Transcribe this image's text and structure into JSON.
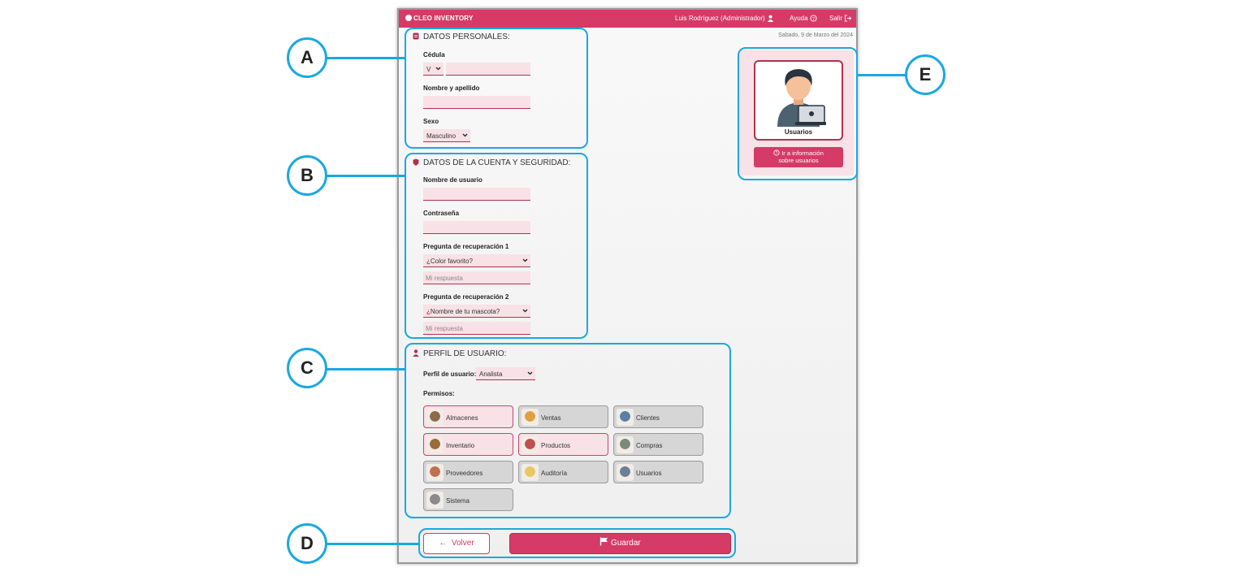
{
  "app": {
    "brand": "CLEO INVENTORY",
    "user": "Luis Rodríguez (Administrador)",
    "help": "Ayuda",
    "exit": "Salir",
    "date": "Sabado, 9 de Marzo del 2024"
  },
  "personal": {
    "title": "DATOS PERSONALES:",
    "cedula_label": "Cédula",
    "cedula_prefix": "V",
    "cedula_value": "",
    "name_label": "Nombre y apellido",
    "name_value": "",
    "sex_label": "Sexo",
    "sex_value": "Masculino"
  },
  "account": {
    "title": "DATOS DE LA CUENTA Y SEGURIDAD:",
    "username_label": "Nombre de usuario",
    "username_value": "",
    "password_label": "Contraseña",
    "password_value": "",
    "q1_label": "Pregunta de recuperación 1",
    "q1_value": "¿Color favorito?",
    "a1_placeholder": "Mi respuesta",
    "q2_label": "Pregunta de recuperación 2",
    "q2_value": "¿Nombre de tu mascota?",
    "a2_placeholder": "Mi respuesta"
  },
  "profile": {
    "title": "PERFIL DE USUARIO:",
    "profile_label": "Perfil de usuario:",
    "profile_value": "Analista",
    "permissions_label": "Permisos:",
    "permissions": [
      {
        "label": "Almacenes",
        "active": true,
        "icon": "warehouse-icon"
      },
      {
        "label": "Ventas",
        "active": false,
        "icon": "sales-icon"
      },
      {
        "label": "Clientes",
        "active": false,
        "icon": "clients-icon"
      },
      {
        "label": "Inventario",
        "active": true,
        "icon": "inventory-icon"
      },
      {
        "label": "Productos",
        "active": true,
        "icon": "products-icon"
      },
      {
        "label": "Compras",
        "active": false,
        "icon": "purchases-icon"
      },
      {
        "label": "Proveedores",
        "active": false,
        "icon": "suppliers-icon"
      },
      {
        "label": "Auditoría",
        "active": false,
        "icon": "audit-icon"
      },
      {
        "label": "Usuarios",
        "active": false,
        "icon": "users-icon"
      },
      {
        "label": "Sistema",
        "active": false,
        "icon": "system-icon"
      }
    ]
  },
  "actions": {
    "back": "Volver",
    "save": "Guardar"
  },
  "side": {
    "card_title": "Usuarios",
    "info_line1": "Ir a información",
    "info_line2": "sobre usuarios"
  },
  "callouts": [
    "A",
    "B",
    "C",
    "D",
    "E"
  ],
  "colors": {
    "primary": "#d63a67",
    "field_bg": "#f8e1e7",
    "highlight": "#1aa8e0"
  }
}
